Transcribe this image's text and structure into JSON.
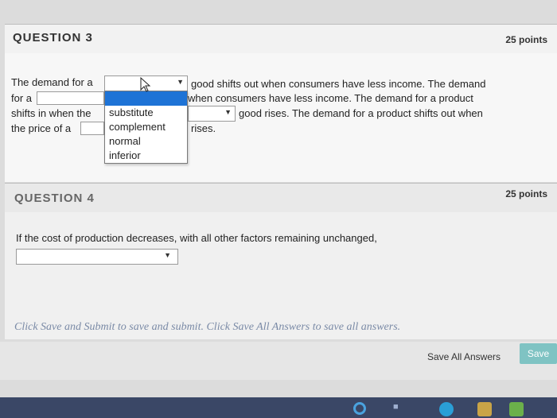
{
  "question3": {
    "title": "QUESTION 3",
    "points": "25 points",
    "line1_start": "The demand for a",
    "line1_end": "good shifts out when consumers have less income. The demand",
    "line2_start": "for a",
    "line2_end": "when consumers have less income. The demand for a product",
    "line3_start": "shifts in when the",
    "line3_end": "good rises. The demand for a product shifts out when",
    "line4_start": "the price of a",
    "line4_end": "rises.",
    "dropdown_options": [
      "substitute",
      "complement",
      "normal",
      "inferior"
    ]
  },
  "question4": {
    "title": "QUESTION 4",
    "points": "25 points",
    "prompt": "If the cost of production decreases, with all other factors remaining unchanged,"
  },
  "footer": {
    "note": "Click Save and Submit to save and submit. Click Save All Answers to save all answers.",
    "save_all_label": "Save All Answers",
    "save_label": "Save"
  },
  "colors": {
    "highlight": "#1e73d6",
    "save_button": "#7fc3c3",
    "footer_note": "#7a8aa6",
    "taskbar": "#3a4766"
  },
  "icons": [
    "chevron-down-icon",
    "mouse-cursor-icon",
    "taskbar-app-icon"
  ]
}
